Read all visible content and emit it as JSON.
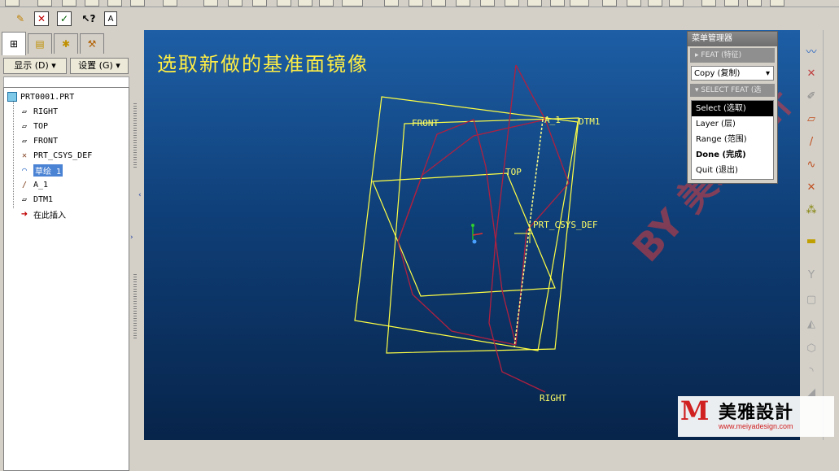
{
  "toolbar": {
    "icons": [
      "sketch-icon",
      "delete-icon",
      "check-icon",
      "help-icon",
      "text-icon"
    ]
  },
  "left_panel": {
    "display_menu": "显示 (D)",
    "settings_menu": "设置 (G)",
    "tree": [
      {
        "label": "PRT0001.PRT",
        "icon": "part-icon",
        "indent": 0
      },
      {
        "label": "RIGHT",
        "icon": "plane-icon",
        "indent": 1
      },
      {
        "label": "TOP",
        "icon": "plane-icon",
        "indent": 1
      },
      {
        "label": "FRONT",
        "icon": "plane-icon",
        "indent": 1
      },
      {
        "label": "PRT_CSYS_DEF",
        "icon": "csys-icon",
        "indent": 1
      },
      {
        "label": "草绘 1",
        "icon": "sketch-icon",
        "indent": 1,
        "selected": true
      },
      {
        "label": "A_1",
        "icon": "axis-icon",
        "indent": 1
      },
      {
        "label": "DTM1",
        "icon": "plane-icon",
        "indent": 1
      },
      {
        "label": "在此插入",
        "icon": "insert-arrow-icon",
        "indent": 1
      }
    ]
  },
  "viewport": {
    "title": "选取新做的基准面镜像",
    "labels": {
      "front": "FRONT",
      "a1": "A_1",
      "dtm1": "DTM1",
      "top": "TOP",
      "csys": "PRT_CSYS_DEF",
      "right": "RIGHT"
    },
    "colors": {
      "datum": "#ffff44",
      "sketch": "#b02040",
      "background": "#0f3f78"
    }
  },
  "menu_manager": {
    "title": "菜单管理器",
    "section_feat": "FEAT (特征)",
    "copy_value": "Copy (复制)",
    "section_select": "SELECT FEAT (选",
    "items": [
      {
        "label": "Select (选取)",
        "highlighted": true,
        "bold": false
      },
      {
        "label": "Layer (层)",
        "highlighted": false,
        "bold": false
      },
      {
        "label": "Range (范围)",
        "highlighted": false,
        "bold": false
      },
      {
        "label": "Done (完成)",
        "highlighted": false,
        "bold": true
      },
      {
        "label": "Quit (退出)",
        "highlighted": false,
        "bold": false
      }
    ]
  },
  "watermark": {
    "diagonal": "BY 美雅設計",
    "logo_cn": "美雅設計",
    "logo_url": "www.meiyadesign.com"
  }
}
